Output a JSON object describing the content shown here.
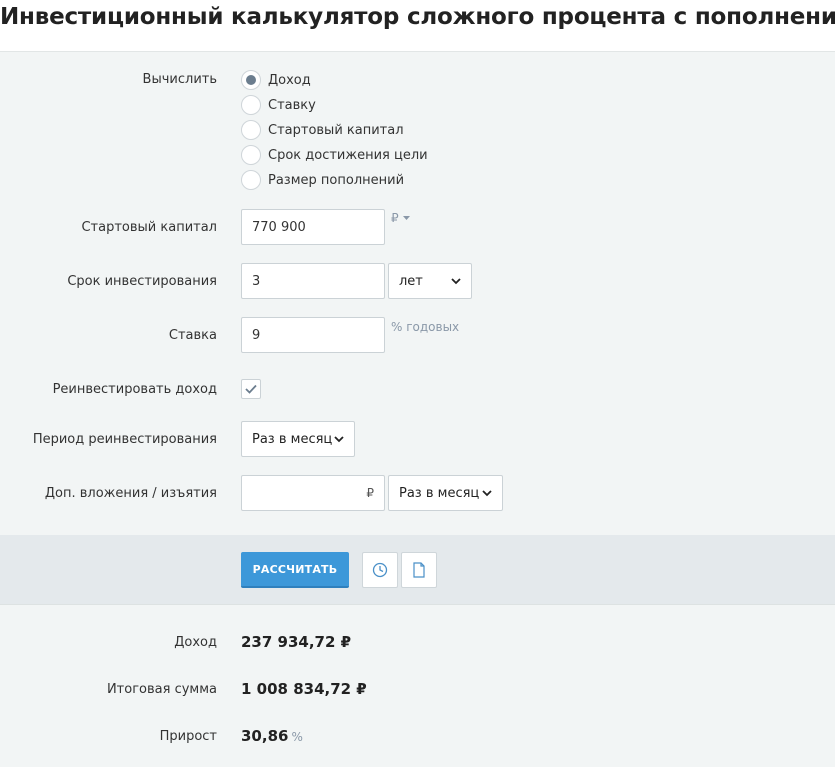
{
  "title": "Инвестиционный калькулятор сложного процента с пополнением",
  "calculate": {
    "label": "Вычислить",
    "options": [
      "Доход",
      "Ставку",
      "Стартовый капитал",
      "Срок достижения цели",
      "Размер пополнений"
    ],
    "selected": "Доход"
  },
  "start_capital": {
    "label": "Стартовый капитал",
    "value": "770 900",
    "currency": "₽"
  },
  "term": {
    "label": "Срок инвестирования",
    "value": "3",
    "unit": "лет"
  },
  "rate": {
    "label": "Ставка",
    "value": "9",
    "unit": "% годовых"
  },
  "reinvest": {
    "label": "Реинвестировать доход",
    "checked": true
  },
  "reinvest_period": {
    "label": "Период реинвестирования",
    "value": "Раз в месяц"
  },
  "additions": {
    "label": "Доп. вложения / изъятия",
    "value": "",
    "currency": "₽",
    "period": "Раз в месяц"
  },
  "actions": {
    "calculate_label": "РАССЧИТАТЬ",
    "history_icon": "clock-icon",
    "document_icon": "document-icon"
  },
  "results": {
    "income": {
      "label": "Доход",
      "value": "237 934,72 ₽"
    },
    "total": {
      "label": "Итоговая сумма",
      "value": "1 008 834,72 ₽"
    },
    "growth": {
      "label": "Прирост",
      "value": "30,86",
      "unit": "%"
    }
  },
  "colors": {
    "primary_button": "#3d98d9",
    "panel_bg": "#f2f5f5",
    "action_bar_bg": "#e4e9ec",
    "muted_text": "#8a98a8"
  }
}
